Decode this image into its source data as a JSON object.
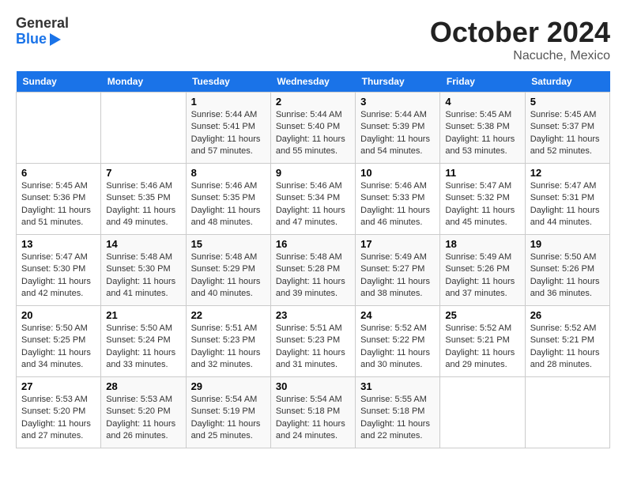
{
  "header": {
    "logo_general": "General",
    "logo_blue": "Blue",
    "month": "October 2024",
    "location": "Nacuche, Mexico"
  },
  "weekdays": [
    "Sunday",
    "Monday",
    "Tuesday",
    "Wednesday",
    "Thursday",
    "Friday",
    "Saturday"
  ],
  "weeks": [
    [
      {
        "day": "",
        "sunrise": "",
        "sunset": "",
        "daylight": "",
        "empty": true
      },
      {
        "day": "",
        "sunrise": "",
        "sunset": "",
        "daylight": "",
        "empty": true
      },
      {
        "day": "1",
        "sunrise": "Sunrise: 5:44 AM",
        "sunset": "Sunset: 5:41 PM",
        "daylight": "Daylight: 11 hours and 57 minutes."
      },
      {
        "day": "2",
        "sunrise": "Sunrise: 5:44 AM",
        "sunset": "Sunset: 5:40 PM",
        "daylight": "Daylight: 11 hours and 55 minutes."
      },
      {
        "day": "3",
        "sunrise": "Sunrise: 5:44 AM",
        "sunset": "Sunset: 5:39 PM",
        "daylight": "Daylight: 11 hours and 54 minutes."
      },
      {
        "day": "4",
        "sunrise": "Sunrise: 5:45 AM",
        "sunset": "Sunset: 5:38 PM",
        "daylight": "Daylight: 11 hours and 53 minutes."
      },
      {
        "day": "5",
        "sunrise": "Sunrise: 5:45 AM",
        "sunset": "Sunset: 5:37 PM",
        "daylight": "Daylight: 11 hours and 52 minutes."
      }
    ],
    [
      {
        "day": "6",
        "sunrise": "Sunrise: 5:45 AM",
        "sunset": "Sunset: 5:36 PM",
        "daylight": "Daylight: 11 hours and 51 minutes."
      },
      {
        "day": "7",
        "sunrise": "Sunrise: 5:46 AM",
        "sunset": "Sunset: 5:35 PM",
        "daylight": "Daylight: 11 hours and 49 minutes."
      },
      {
        "day": "8",
        "sunrise": "Sunrise: 5:46 AM",
        "sunset": "Sunset: 5:35 PM",
        "daylight": "Daylight: 11 hours and 48 minutes."
      },
      {
        "day": "9",
        "sunrise": "Sunrise: 5:46 AM",
        "sunset": "Sunset: 5:34 PM",
        "daylight": "Daylight: 11 hours and 47 minutes."
      },
      {
        "day": "10",
        "sunrise": "Sunrise: 5:46 AM",
        "sunset": "Sunset: 5:33 PM",
        "daylight": "Daylight: 11 hours and 46 minutes."
      },
      {
        "day": "11",
        "sunrise": "Sunrise: 5:47 AM",
        "sunset": "Sunset: 5:32 PM",
        "daylight": "Daylight: 11 hours and 45 minutes."
      },
      {
        "day": "12",
        "sunrise": "Sunrise: 5:47 AM",
        "sunset": "Sunset: 5:31 PM",
        "daylight": "Daylight: 11 hours and 44 minutes."
      }
    ],
    [
      {
        "day": "13",
        "sunrise": "Sunrise: 5:47 AM",
        "sunset": "Sunset: 5:30 PM",
        "daylight": "Daylight: 11 hours and 42 minutes."
      },
      {
        "day": "14",
        "sunrise": "Sunrise: 5:48 AM",
        "sunset": "Sunset: 5:30 PM",
        "daylight": "Daylight: 11 hours and 41 minutes."
      },
      {
        "day": "15",
        "sunrise": "Sunrise: 5:48 AM",
        "sunset": "Sunset: 5:29 PM",
        "daylight": "Daylight: 11 hours and 40 minutes."
      },
      {
        "day": "16",
        "sunrise": "Sunrise: 5:48 AM",
        "sunset": "Sunset: 5:28 PM",
        "daylight": "Daylight: 11 hours and 39 minutes."
      },
      {
        "day": "17",
        "sunrise": "Sunrise: 5:49 AM",
        "sunset": "Sunset: 5:27 PM",
        "daylight": "Daylight: 11 hours and 38 minutes."
      },
      {
        "day": "18",
        "sunrise": "Sunrise: 5:49 AM",
        "sunset": "Sunset: 5:26 PM",
        "daylight": "Daylight: 11 hours and 37 minutes."
      },
      {
        "day": "19",
        "sunrise": "Sunrise: 5:50 AM",
        "sunset": "Sunset: 5:26 PM",
        "daylight": "Daylight: 11 hours and 36 minutes."
      }
    ],
    [
      {
        "day": "20",
        "sunrise": "Sunrise: 5:50 AM",
        "sunset": "Sunset: 5:25 PM",
        "daylight": "Daylight: 11 hours and 34 minutes."
      },
      {
        "day": "21",
        "sunrise": "Sunrise: 5:50 AM",
        "sunset": "Sunset: 5:24 PM",
        "daylight": "Daylight: 11 hours and 33 minutes."
      },
      {
        "day": "22",
        "sunrise": "Sunrise: 5:51 AM",
        "sunset": "Sunset: 5:23 PM",
        "daylight": "Daylight: 11 hours and 32 minutes."
      },
      {
        "day": "23",
        "sunrise": "Sunrise: 5:51 AM",
        "sunset": "Sunset: 5:23 PM",
        "daylight": "Daylight: 11 hours and 31 minutes."
      },
      {
        "day": "24",
        "sunrise": "Sunrise: 5:52 AM",
        "sunset": "Sunset: 5:22 PM",
        "daylight": "Daylight: 11 hours and 30 minutes."
      },
      {
        "day": "25",
        "sunrise": "Sunrise: 5:52 AM",
        "sunset": "Sunset: 5:21 PM",
        "daylight": "Daylight: 11 hours and 29 minutes."
      },
      {
        "day": "26",
        "sunrise": "Sunrise: 5:52 AM",
        "sunset": "Sunset: 5:21 PM",
        "daylight": "Daylight: 11 hours and 28 minutes."
      }
    ],
    [
      {
        "day": "27",
        "sunrise": "Sunrise: 5:53 AM",
        "sunset": "Sunset: 5:20 PM",
        "daylight": "Daylight: 11 hours and 27 minutes."
      },
      {
        "day": "28",
        "sunrise": "Sunrise: 5:53 AM",
        "sunset": "Sunset: 5:20 PM",
        "daylight": "Daylight: 11 hours and 26 minutes."
      },
      {
        "day": "29",
        "sunrise": "Sunrise: 5:54 AM",
        "sunset": "Sunset: 5:19 PM",
        "daylight": "Daylight: 11 hours and 25 minutes."
      },
      {
        "day": "30",
        "sunrise": "Sunrise: 5:54 AM",
        "sunset": "Sunset: 5:18 PM",
        "daylight": "Daylight: 11 hours and 24 minutes."
      },
      {
        "day": "31",
        "sunrise": "Sunrise: 5:55 AM",
        "sunset": "Sunset: 5:18 PM",
        "daylight": "Daylight: 11 hours and 22 minutes."
      },
      {
        "day": "",
        "sunrise": "",
        "sunset": "",
        "daylight": "",
        "empty": true
      },
      {
        "day": "",
        "sunrise": "",
        "sunset": "",
        "daylight": "",
        "empty": true
      }
    ]
  ]
}
